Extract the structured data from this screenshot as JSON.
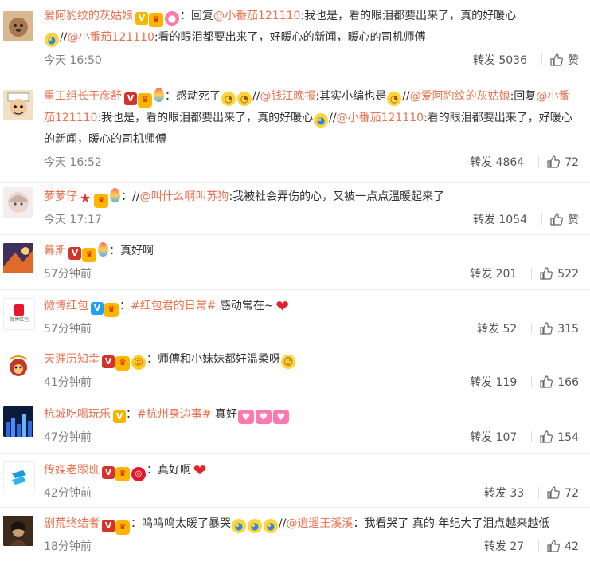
{
  "comments": [
    {
      "user": "爱阿豹纹的灰姑娘",
      "reply_prefix": "：回复",
      "at1": "@小番茄121110",
      "text1": ":我也是，看的眼泪都要出来了，真的好暖心",
      "sep": "//",
      "at2": "@小番茄121110",
      "text2": ":看的眼泪都要出来了，好暖心的新闻，暖心的司机师傅",
      "time": "今天 16:50",
      "repost_label": "转发",
      "repost": "5036",
      "like": "赞"
    },
    {
      "user": "重工组长于彦舒",
      "text_a": "：感动死了",
      "sep1": "//",
      "at1": "@钱江晚报",
      "text_b": ":其实小编也是",
      "sep2": "//",
      "at2": "@爱阿豹纹的灰姑娘",
      "text_c": ":回复",
      "at3": "@小番茄121110",
      "text_d": ":我也是，看的眼泪都要出来了，真的好暖心",
      "sep3": "//",
      "at4": "@小番茄121110",
      "text_e": ":看的眼泪都要出来了，好暖心的新闻，暖心的司机师傅",
      "time": "今天 16:52",
      "repost_label": "转发",
      "repost": "4864",
      "like": "72"
    },
    {
      "user": "萝萝仔",
      "sep": "：//",
      "at1": "@叫什么啊叫苏狗",
      "text": ":我被社会弄伤的心，又被一点点温暖起来了",
      "time": "今天 17:17",
      "repost_label": "转发",
      "repost": "1054",
      "like": "赞"
    },
    {
      "user": "幕斯",
      "text": "：真好啊",
      "time": "57分钟前",
      "repost_label": "转发",
      "repost": "201",
      "like": "522"
    },
    {
      "user": "微博红包",
      "prefix": "：",
      "topic": "#红包君的日常#",
      "text": " 感动常在~",
      "time": "57分钟前",
      "repost_label": "转发",
      "repost": "52",
      "like": "315",
      "avatar_text": "微博红包"
    },
    {
      "user": "天涯历知幸",
      "text": "：师傅和小妹妹都好温柔呀",
      "time": "41分钟前",
      "repost_label": "转发",
      "repost": "119",
      "like": "166"
    },
    {
      "user": "杭城吃喝玩乐",
      "prefix": "：",
      "topic": "#杭州身边事#",
      "text": " 真好",
      "time": "47分钟前",
      "repost_label": "转发",
      "repost": "107",
      "like": "154"
    },
    {
      "user": "传媒老跟班",
      "text": "：真好啊",
      "time": "42分钟前",
      "repost_label": "转发",
      "repost": "33",
      "like": "72"
    },
    {
      "user": "剧荒终结者",
      "text_a": "：呜呜呜太暖了暴哭",
      "sep": "//",
      "at1": "@逍遥王溪溪",
      "text_b": "：我看哭了 真的 年纪大了泪点越来越低",
      "time": "18分钟前",
      "repost_label": "转发",
      "repost": "27",
      "like": "42"
    }
  ],
  "colors": {
    "link": "#eb7350",
    "meta": "#808080",
    "border": "#ececec"
  }
}
